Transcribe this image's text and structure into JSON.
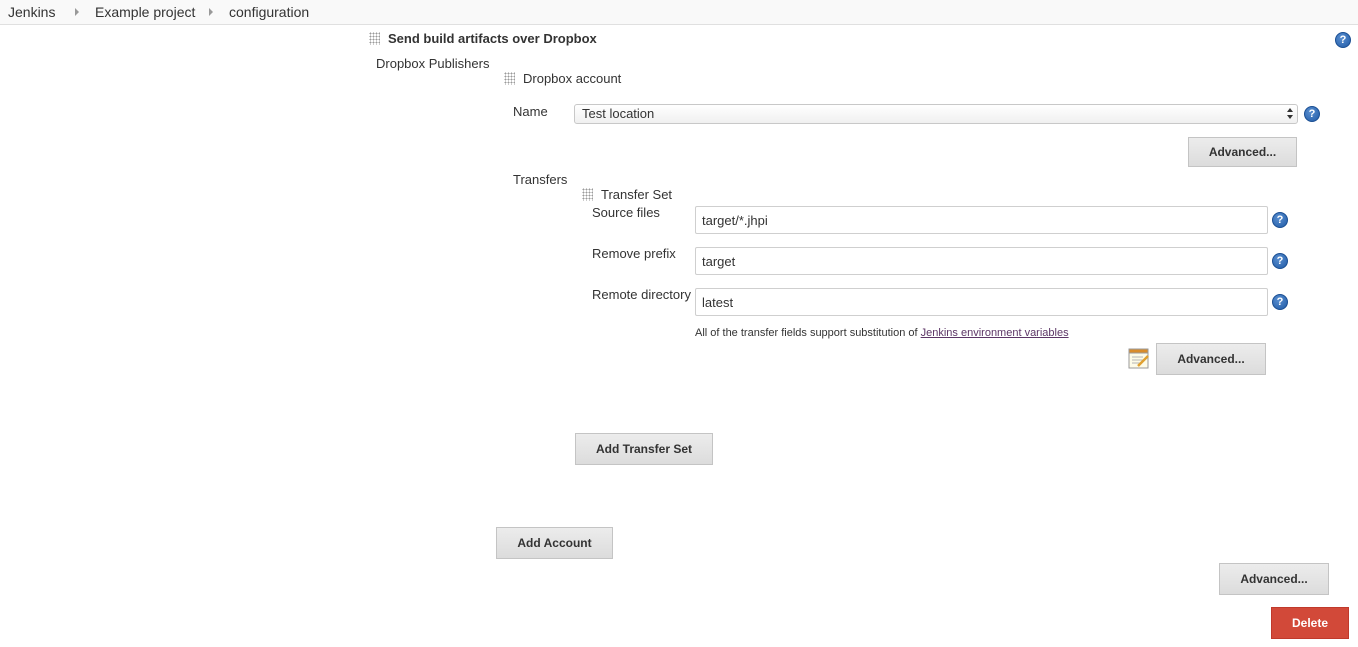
{
  "breadcrumb": {
    "items": [
      "Jenkins",
      "Example project",
      "configuration"
    ]
  },
  "section": {
    "title": "Send build artifacts over Dropbox",
    "publishers_label": "Dropbox Publishers",
    "account_title": "Dropbox account",
    "help_icon": "?"
  },
  "account": {
    "name_label": "Name",
    "name_value": "Test location",
    "advanced_label": "Advanced...",
    "transfers_label": "Transfers"
  },
  "transfer_set": {
    "title": "Transfer Set",
    "source_files_label": "Source files",
    "source_files_value": "target/*.jhpi",
    "remove_prefix_label": "Remove prefix",
    "remove_prefix_value": "target",
    "remote_directory_label": "Remote directory",
    "remote_directory_value": "latest",
    "hint_text": "All of the transfer fields support substitution of ",
    "hint_link": "Jenkins environment variables",
    "advanced_label": "Advanced...",
    "notepad_icon": "notepad-icon"
  },
  "buttons": {
    "add_transfer_set": "Add Transfer Set",
    "add_account": "Add Account",
    "advanced": "Advanced...",
    "delete": "Delete"
  },
  "colors": {
    "help_icon": "#2e6bb7",
    "delete_button": "#d24939",
    "link": "#5c3566"
  }
}
